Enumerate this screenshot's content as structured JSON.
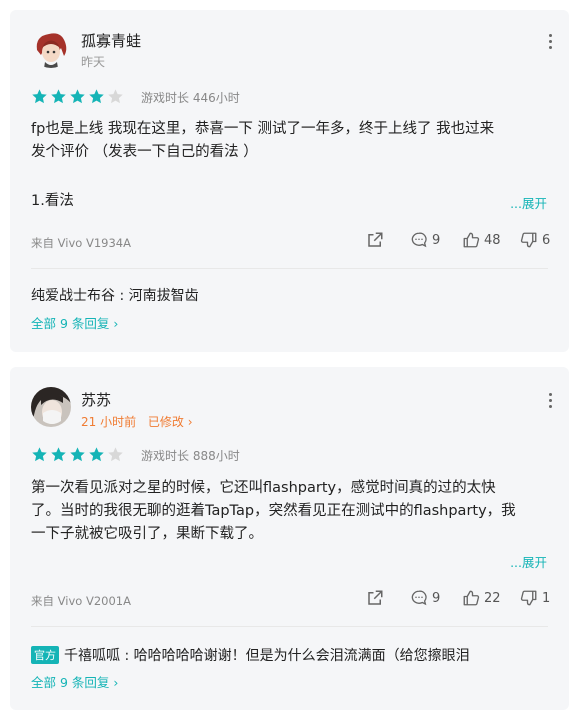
{
  "reviews": [
    {
      "username": "孤寡青蛙",
      "date": "昨天",
      "edited": "",
      "rating": 4,
      "playtime": "游戏时长 446小时",
      "text_line1": "fp也是上线 我现在这里，恭喜一下 测试了一年多，终于上线了 我也过来",
      "text_line2": "发个评价 （发表一下自己的看法 ）",
      "text_line3": "",
      "text_extra": "1.看法",
      "expand": "...展开",
      "device": "来自 Vivo V1934A",
      "comments": "9",
      "likes": "48",
      "dislikes": "6",
      "reply_badge": "",
      "reply": "纯爱战士布谷 : 河南拔智齿",
      "reply_all": "全部 9 条回复"
    },
    {
      "username": "苏苏",
      "date": "21 小时前",
      "edited": "已修改",
      "rating": 4,
      "playtime": "游戏时长 888小时",
      "text_line1": "第一次看见派对之星的时候，它还叫flashparty，感觉时间真的过的太快",
      "text_line2": "了。当时的我很无聊的逛着TapTap，突然看见正在测试中的flashparty，我",
      "text_line3": "一下子就被它吸引了，果断下载了。",
      "text_extra": "",
      "expand": "...展开",
      "device": "来自 Vivo V2001A",
      "comments": "9",
      "likes": "22",
      "dislikes": "1",
      "reply_badge": "官方",
      "reply": "千禧呱呱 : 哈哈哈哈哈谢谢！但是为什么会泪流满面（给您擦眼泪",
      "reply_all": "全部 9 条回复"
    }
  ],
  "colors": {
    "accent": "#15b4b6",
    "edited": "#f07c33",
    "star_on": "#15b4b6",
    "star_off": "#d8d8d8"
  }
}
